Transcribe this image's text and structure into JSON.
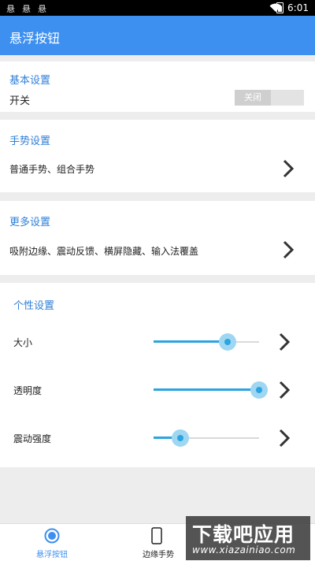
{
  "status_bar": {
    "notifications": [
      "悬",
      "悬",
      "悬"
    ],
    "time": "6:01",
    "icons": [
      "wifi-icon",
      "battery-icon"
    ]
  },
  "app_bar": {
    "title": "悬浮按钮"
  },
  "basic": {
    "title": "基本设置",
    "switch_label": "开关",
    "switch_state": "关闭"
  },
  "gesture": {
    "title": "手势设置",
    "item": "普通手势、组合手势"
  },
  "more": {
    "title": "更多设置",
    "item": "吸附边缘、震动反馈、横屏隐藏、输入法覆盖"
  },
  "personal": {
    "title": "个性设置",
    "sliders": [
      {
        "label": "大小",
        "value": 0.7
      },
      {
        "label": "透明度",
        "value": 1.0
      },
      {
        "label": "震动强度",
        "value": 0.25
      }
    ]
  },
  "bottom_nav": {
    "items": [
      {
        "label": "悬浮按钮",
        "active": true
      },
      {
        "label": "边缘手势",
        "active": false
      }
    ]
  },
  "watermark": {
    "line1": "下载吧应用",
    "line2": "www.xiazainiao.com"
  },
  "colors": {
    "accent": "#3d8ff0",
    "section_title": "#2f7fd8",
    "slider": "#2ba4df",
    "slider_halo": "#9fd6f2"
  }
}
